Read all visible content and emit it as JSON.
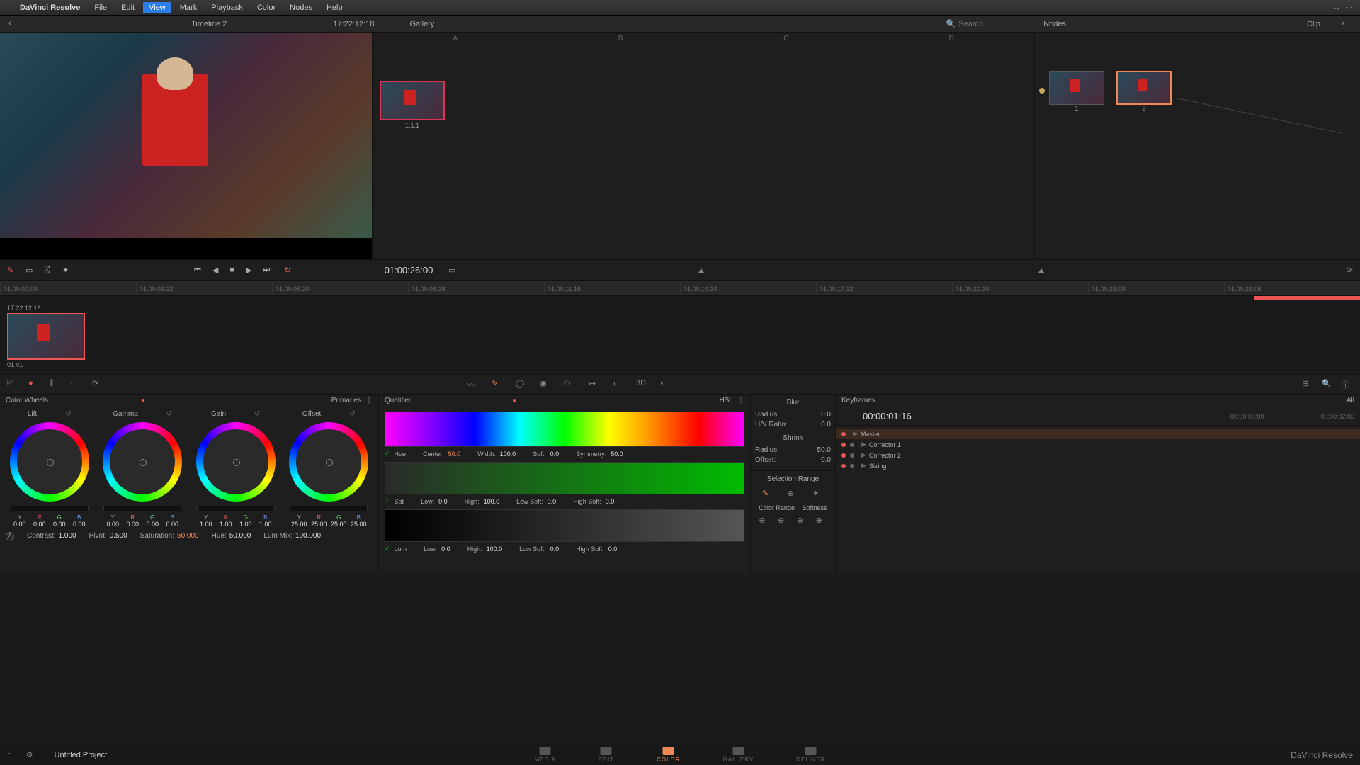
{
  "menubar": {
    "app": "DaVinci Resolve",
    "items": [
      "File",
      "Edit",
      "View",
      "Mark",
      "Playback",
      "Color",
      "Nodes",
      "Help"
    ],
    "active_index": 2
  },
  "toolbar": {
    "timeline_name": "Timeline 2",
    "timecode": "17:22:12:18",
    "gallery_label": "Gallery",
    "search_placeholder": "Search",
    "nodes_label": "Nodes",
    "clip_label": "Clip"
  },
  "gallery": {
    "cols": [
      "A",
      "B",
      "C",
      "D"
    ],
    "thumb_label": "1.1.1"
  },
  "nodes": {
    "items": [
      {
        "label": "1"
      },
      {
        "label": "2"
      }
    ]
  },
  "transport": {
    "timecode": "01:00:26:00"
  },
  "ruler": {
    "ticks": [
      "01:00:00:00",
      "01:00:02:22",
      "01:00:05:20",
      "01:00:08:18",
      "01:00:11:16",
      "01:00:14:14",
      "01:00:17:12",
      "01:00:20:10",
      "01:00:23:08",
      "01:00:26:06"
    ]
  },
  "thumb": {
    "tc": "17:22:12:18",
    "label": "01  v1"
  },
  "color_wheels": {
    "title": "Color Wheels",
    "mode": "Primaries",
    "wheels": [
      {
        "name": "Lift",
        "y": "0.00",
        "r": "0.00",
        "g": "0.00",
        "b": "0.00"
      },
      {
        "name": "Gamma",
        "y": "0.00",
        "r": "0.00",
        "g": "0.00",
        "b": "0.00"
      },
      {
        "name": "Gain",
        "y": "1.00",
        "r": "1.00",
        "g": "1.00",
        "b": "1.00"
      },
      {
        "name": "Offset",
        "y": "25.00",
        "r": "25.00",
        "g": "25.00",
        "b": "25.00"
      }
    ],
    "params": {
      "contrast_label": "Contrast:",
      "contrast": "1.000",
      "pivot_label": "Pivot:",
      "pivot": "0.500",
      "saturation_label": "Saturation:",
      "saturation": "50.000",
      "hue_label": "Hue:",
      "hue": "50.000",
      "lummix_label": "Lum Mix:",
      "lummix": "100.000"
    }
  },
  "qualifier": {
    "title": "Qualifier",
    "mode": "HSL",
    "hue": {
      "check": "✓",
      "name": "Hue",
      "center_l": "Center:",
      "center": "50.0",
      "width_l": "Width:",
      "width": "100.0",
      "soft_l": "Soft:",
      "soft": "0.0",
      "sym_l": "Symmetry:",
      "sym": "50.0"
    },
    "sat": {
      "check": "✓",
      "name": "Sat",
      "low_l": "Low:",
      "low": "0.0",
      "high_l": "High:",
      "high": "100.0",
      "lowsoft_l": "Low Soft:",
      "lowsoft": "0.0",
      "highsoft_l": "High Soft:",
      "highsoft": "0.0"
    },
    "lum": {
      "check": "✓",
      "name": "Lum",
      "low_l": "Low:",
      "low": "0.0",
      "high_l": "High:",
      "high": "100.0",
      "lowsoft_l": "Low Soft:",
      "lowsoft": "0.0",
      "highsoft_l": "High Soft:",
      "highsoft": "0.0"
    }
  },
  "blur": {
    "title": "Blur",
    "radius_l": "Radius:",
    "radius": "0.0",
    "hvratio_l": "H/V Ratio:",
    "hvratio": "0.0",
    "shrink_title": "Shrink",
    "radius2_l": "Radius:",
    "radius2": "50.0",
    "offset_l": "Offset:",
    "offset": "0.0"
  },
  "selrange": {
    "title": "Selection Range",
    "color_range": "Color Range",
    "softness": "Softness"
  },
  "keyframes": {
    "title": "Keyframes",
    "mode": "All",
    "tc": "00:00:01:16",
    "range_start": "00:00:00:00",
    "range_end": "00:00:02:00",
    "tracks": [
      "Master",
      "Corrector 1",
      "Corrector 2",
      "Sizing"
    ]
  },
  "pagebar": {
    "project": "Untitled Project",
    "items": [
      "MEDIA",
      "EDIT",
      "COLOR",
      "GALLERY",
      "DELIVER"
    ],
    "active_index": 2,
    "brand": "DaVinci Resolve"
  },
  "labels": {
    "y": "Y",
    "r": "R",
    "g": "G",
    "b": "B",
    "t3d": "3D"
  }
}
